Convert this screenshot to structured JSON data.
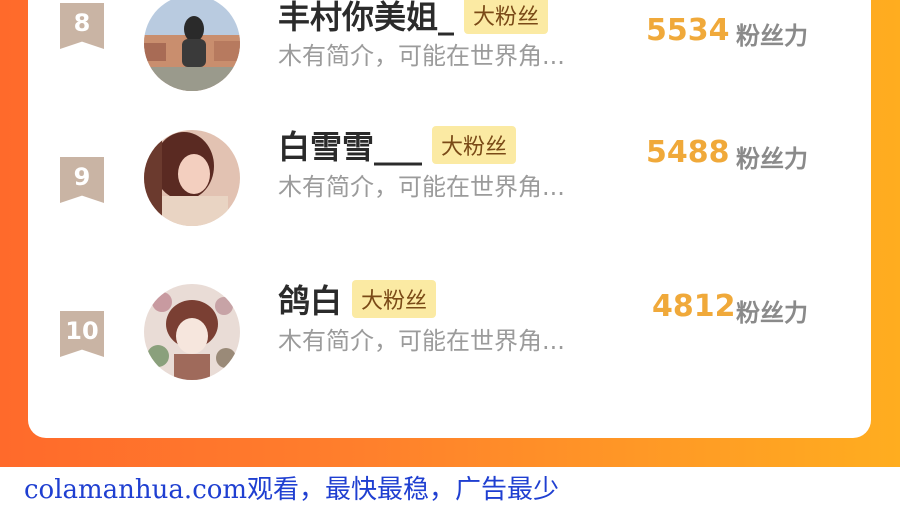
{
  "leaderboard": {
    "rows": [
      {
        "rank": "8",
        "name": "丰村你美姐_",
        "badge": "大粉丝",
        "description": "木有简介，可能在世界角...",
        "score": "5534",
        "score_unit": "粉丝力"
      },
      {
        "rank": "9",
        "name": "白雪雪___",
        "badge": "大粉丝",
        "description": "木有简介，可能在世界角...",
        "score": "5488",
        "score_unit": "粉丝力"
      },
      {
        "rank": "10",
        "name": "鸽白",
        "badge": "大粉丝",
        "description": "木有简介，可能在世界角...",
        "score": "4812",
        "score_unit": "粉丝力"
      }
    ]
  },
  "footer": {
    "text": "colamanhua.com观看，最快最稳，广告最少"
  },
  "colors": {
    "accent_orange": "#ff7f2c",
    "score": "#f0a93a",
    "badge_bg": "#fbeaa3",
    "footer_link": "#1f3fd1"
  }
}
